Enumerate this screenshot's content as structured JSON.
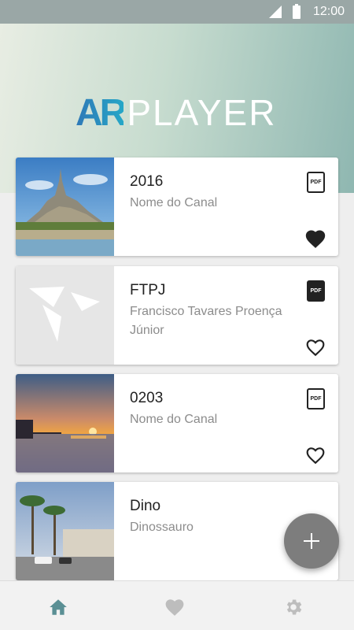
{
  "status_bar": {
    "time": "12:00"
  },
  "logo": {
    "ar": "AR",
    "player": "PLAYER"
  },
  "cards": [
    {
      "title": "2016",
      "subtitle": "Nome do Canal",
      "badge": "PDF",
      "favorite": true
    },
    {
      "title": "FTPJ",
      "subtitle": "Francisco Tavares Proença Júnior",
      "badge": "PDF",
      "favorite": false
    },
    {
      "title": "0203",
      "subtitle": "Nome do Canal",
      "badge": "PDF",
      "favorite": false
    },
    {
      "title": "Dino",
      "subtitle": "Dinossauro",
      "badge": "",
      "favorite": false
    }
  ],
  "fab": {
    "icon": "plus-icon"
  },
  "bottom_nav": [
    {
      "icon": "home-icon",
      "active": true,
      "color": "#5a8f94"
    },
    {
      "icon": "heart-icon",
      "active": false,
      "color": "#bdbdbd"
    },
    {
      "icon": "gear-icon",
      "active": false,
      "color": "#bdbdbd"
    }
  ]
}
